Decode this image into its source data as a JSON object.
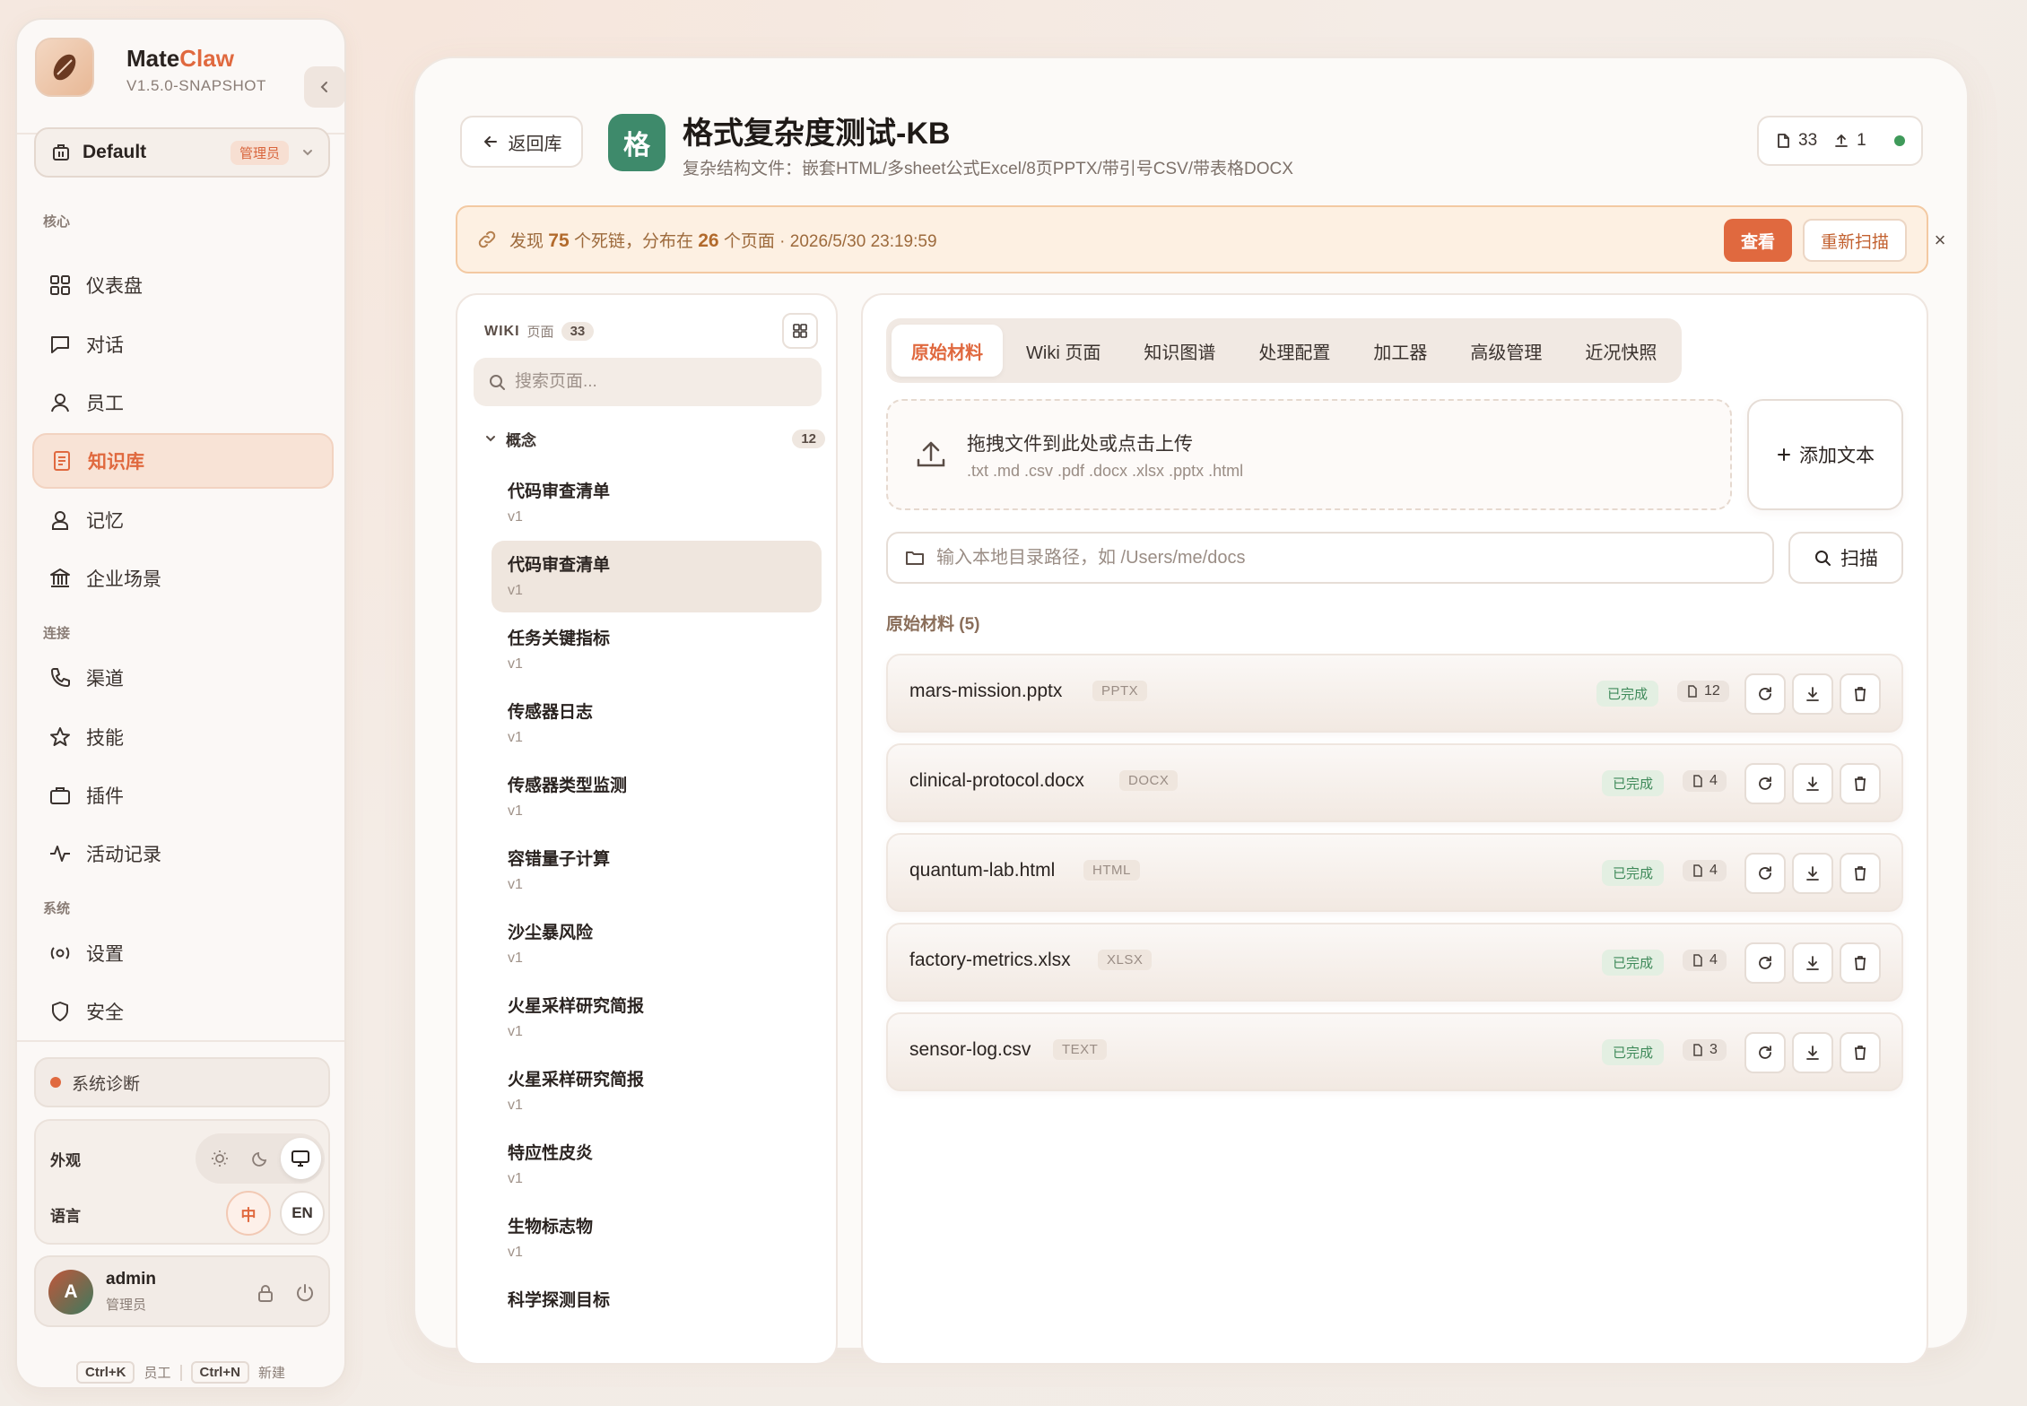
{
  "app": {
    "name_prefix": "Mate",
    "name_suffix": "Claw",
    "version": "V1.5.0-SNAPSHOT"
  },
  "workspace": {
    "name": "Default",
    "badge": "管理员"
  },
  "sidebar": {
    "sections": {
      "core": "核心",
      "connect": "连接",
      "system": "系统"
    },
    "items": [
      {
        "label": "仪表盘",
        "icon": "dashboard-icon"
      },
      {
        "label": "对话",
        "icon": "chat-icon"
      },
      {
        "label": "员工",
        "icon": "user-icon"
      },
      {
        "label": "知识库",
        "icon": "book-icon",
        "active": true
      },
      {
        "label": "记忆",
        "icon": "memory-icon"
      },
      {
        "label": "企业场景",
        "icon": "building-icon"
      },
      {
        "label": "渠道",
        "icon": "phone-icon"
      },
      {
        "label": "技能",
        "icon": "star-icon"
      },
      {
        "label": "插件",
        "icon": "briefcase-icon"
      },
      {
        "label": "活动记录",
        "icon": "activity-icon"
      },
      {
        "label": "设置",
        "icon": "settings-icon"
      },
      {
        "label": "安全",
        "icon": "shield-icon"
      }
    ],
    "diagnostics": "系统诊断",
    "appearance_label": "外观",
    "language_label": "语言",
    "lang_zh": "中",
    "lang_en": "EN",
    "user": {
      "initial": "A",
      "name": "admin",
      "role": "管理员"
    },
    "shortcuts": [
      {
        "key": "Ctrl+K",
        "label": "员工"
      },
      {
        "key": "Ctrl+N",
        "label": "新建"
      }
    ]
  },
  "header": {
    "back_label": "返回库",
    "kb_initial": "格",
    "kb_title": "格式复杂度测试-KB",
    "kb_desc": "复杂结构文件：嵌套HTML/多sheet公式Excel/8页PPTX/带引号CSV/带表格DOCX",
    "doc_count": "33",
    "upload_count": "1"
  },
  "alert": {
    "prefix": "发现",
    "dead_links": "75",
    "mid": "个死链，分布在",
    "pages": "26",
    "suffix": "个页面 · 2026/5/30 23:19:59",
    "view_label": "查看",
    "rescan_label": "重新扫描",
    "close": "×"
  },
  "wiki": {
    "title": "WIKI",
    "subtitle": "页面",
    "count": "33",
    "search_placeholder": "搜索页面...",
    "group_name": "概念",
    "group_count": "12",
    "items": [
      {
        "title": "代码审查清单",
        "version": "v1"
      },
      {
        "title": "代码审查清单",
        "version": "v1",
        "active": true
      },
      {
        "title": "任务关键指标",
        "version": "v1"
      },
      {
        "title": "传感器日志",
        "version": "v1"
      },
      {
        "title": "传感器类型监测",
        "version": "v1"
      },
      {
        "title": "容错量子计算",
        "version": "v1"
      },
      {
        "title": "沙尘暴风险",
        "version": "v1"
      },
      {
        "title": "火星采样研究简报",
        "version": "v1"
      },
      {
        "title": "火星采样研究简报",
        "version": "v1"
      },
      {
        "title": "特应性皮炎",
        "version": "v1"
      },
      {
        "title": "生物标志物",
        "version": "v1"
      },
      {
        "title": "科学探测目标",
        "version": ""
      }
    ]
  },
  "tabs": [
    "原始材料",
    "Wiki 页面",
    "知识图谱",
    "处理配置",
    "加工器",
    "高级管理",
    "近况快照"
  ],
  "upload": {
    "title": "拖拽文件到此处或点击上传",
    "formats": ".txt .md .csv .pdf .docx .xlsx .pptx .html",
    "add_text": "添加文本"
  },
  "scan": {
    "placeholder": "输入本地目录路径，如 /Users/me/docs",
    "button": "扫描"
  },
  "files": {
    "section_title": "原始材料 (5)",
    "items": [
      {
        "name": "mars-mission.pptx",
        "type": "PPTX",
        "status": "已完成",
        "pages": "12"
      },
      {
        "name": "clinical-protocol.docx",
        "type": "DOCX",
        "status": "已完成",
        "pages": "4"
      },
      {
        "name": "quantum-lab.html",
        "type": "HTML",
        "status": "已完成",
        "pages": "4"
      },
      {
        "name": "factory-metrics.xlsx",
        "type": "XLSX",
        "status": "已完成",
        "pages": "4"
      },
      {
        "name": "sensor-log.csv",
        "type": "TEXT",
        "status": "已完成",
        "pages": "3"
      }
    ]
  },
  "colors": {
    "accent": "#e0693f",
    "success": "#3f9a5a",
    "kb_avatar": "#3e8a6b"
  }
}
